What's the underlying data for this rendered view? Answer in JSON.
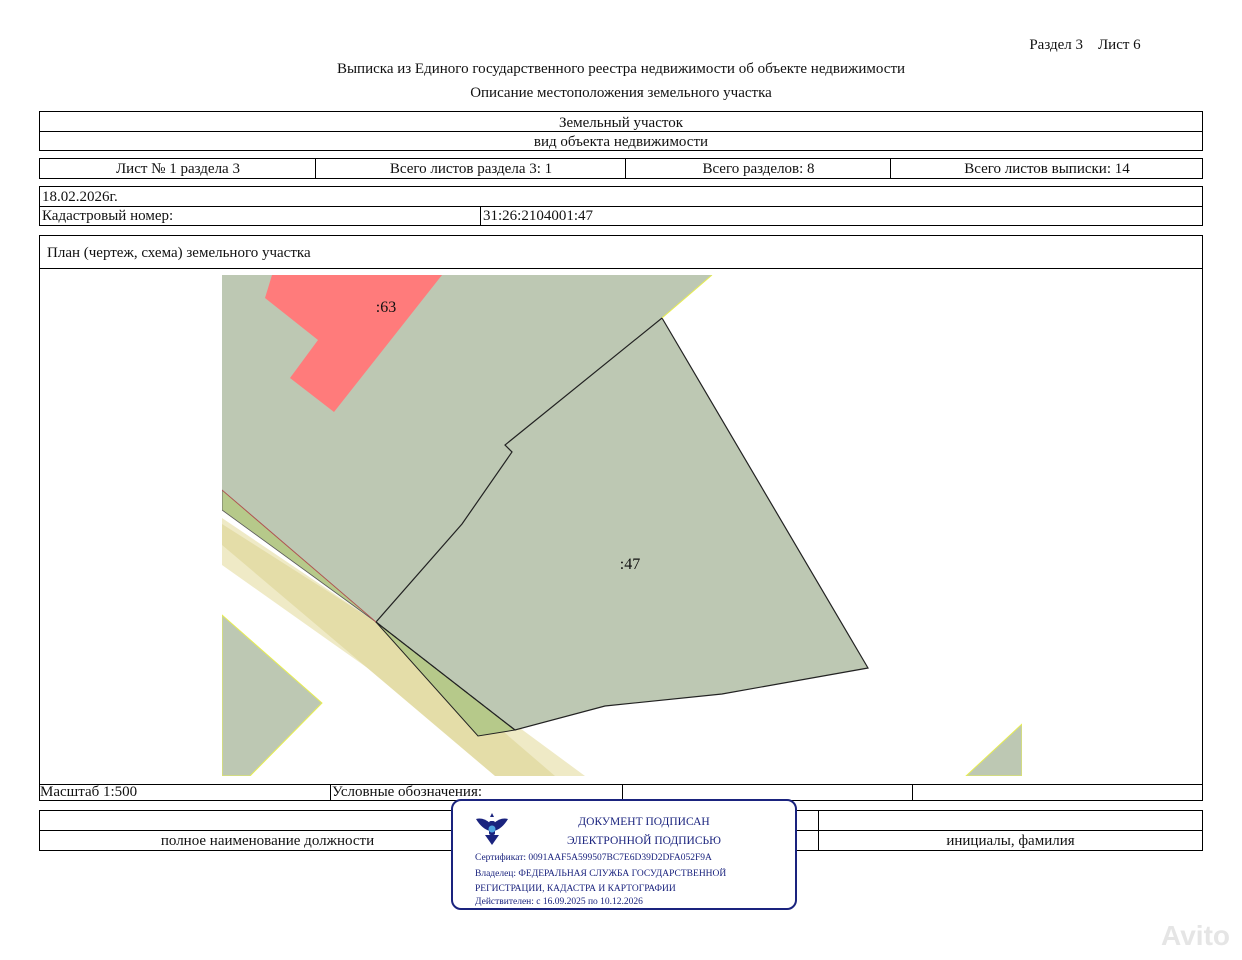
{
  "header": {
    "section_sheet": "Раздел 3    Лист 6",
    "title": "Выписка из Единого государственного реестра недвижимости об объекте недвижимости",
    "subtitle": "Описание местоположения земельного участка"
  },
  "object": {
    "name": "Земельный участок",
    "kind_label": "вид объекта недвижимости"
  },
  "sheets": {
    "sheet_of_section": "Лист № 1 раздела 3",
    "total_section_sheets": "Всего листов раздела 3: 1",
    "total_sections": "Всего разделов: 8",
    "total_extract_sheets": "Всего листов выписки: 14"
  },
  "date": "18.02.2026г.",
  "cadastral": {
    "label": "Кадастровый номер:",
    "value": "31:26:2104001:47"
  },
  "plan": {
    "title": "План (чертеж, схема) земельного участка",
    "labels": {
      "parcel_63": ":63",
      "parcel_47": ":47"
    },
    "colors": {
      "gray_green": "#bdc8b3",
      "red": "#ff7b7b",
      "yellow": "#ede8bf",
      "yellow_dark": "#e2dba4",
      "green": "#b8cc8c"
    }
  },
  "footer": {
    "scale": "Масштаб 1:500",
    "legend_label": "Условные обозначения:",
    "position_caption": "полное наименование должности",
    "name_caption": "инициалы, фамилия"
  },
  "stamp": {
    "line1": "ДОКУМЕНТ ПОДПИСАН",
    "line2": "ЭЛЕКТРОННОЙ ПОДПИСЬЮ",
    "certificate": "Сертификат: 0091AAF5A599507BC7E6D39D2DFA052F9A",
    "owner1": "Владелец: ФЕДЕРАЛЬНАЯ СЛУЖБА ГОСУДАРСТВЕННОЙ",
    "owner2": "РЕГИСТРАЦИИ, КАДАСТРА И КАРТОГРАФИИ",
    "valid": "Действителен: с 16.09.2025 по 10.12.2026",
    "emblem_icon": "double-headed-eagle-icon",
    "color": "#1a237e"
  },
  "watermark": "Avito"
}
